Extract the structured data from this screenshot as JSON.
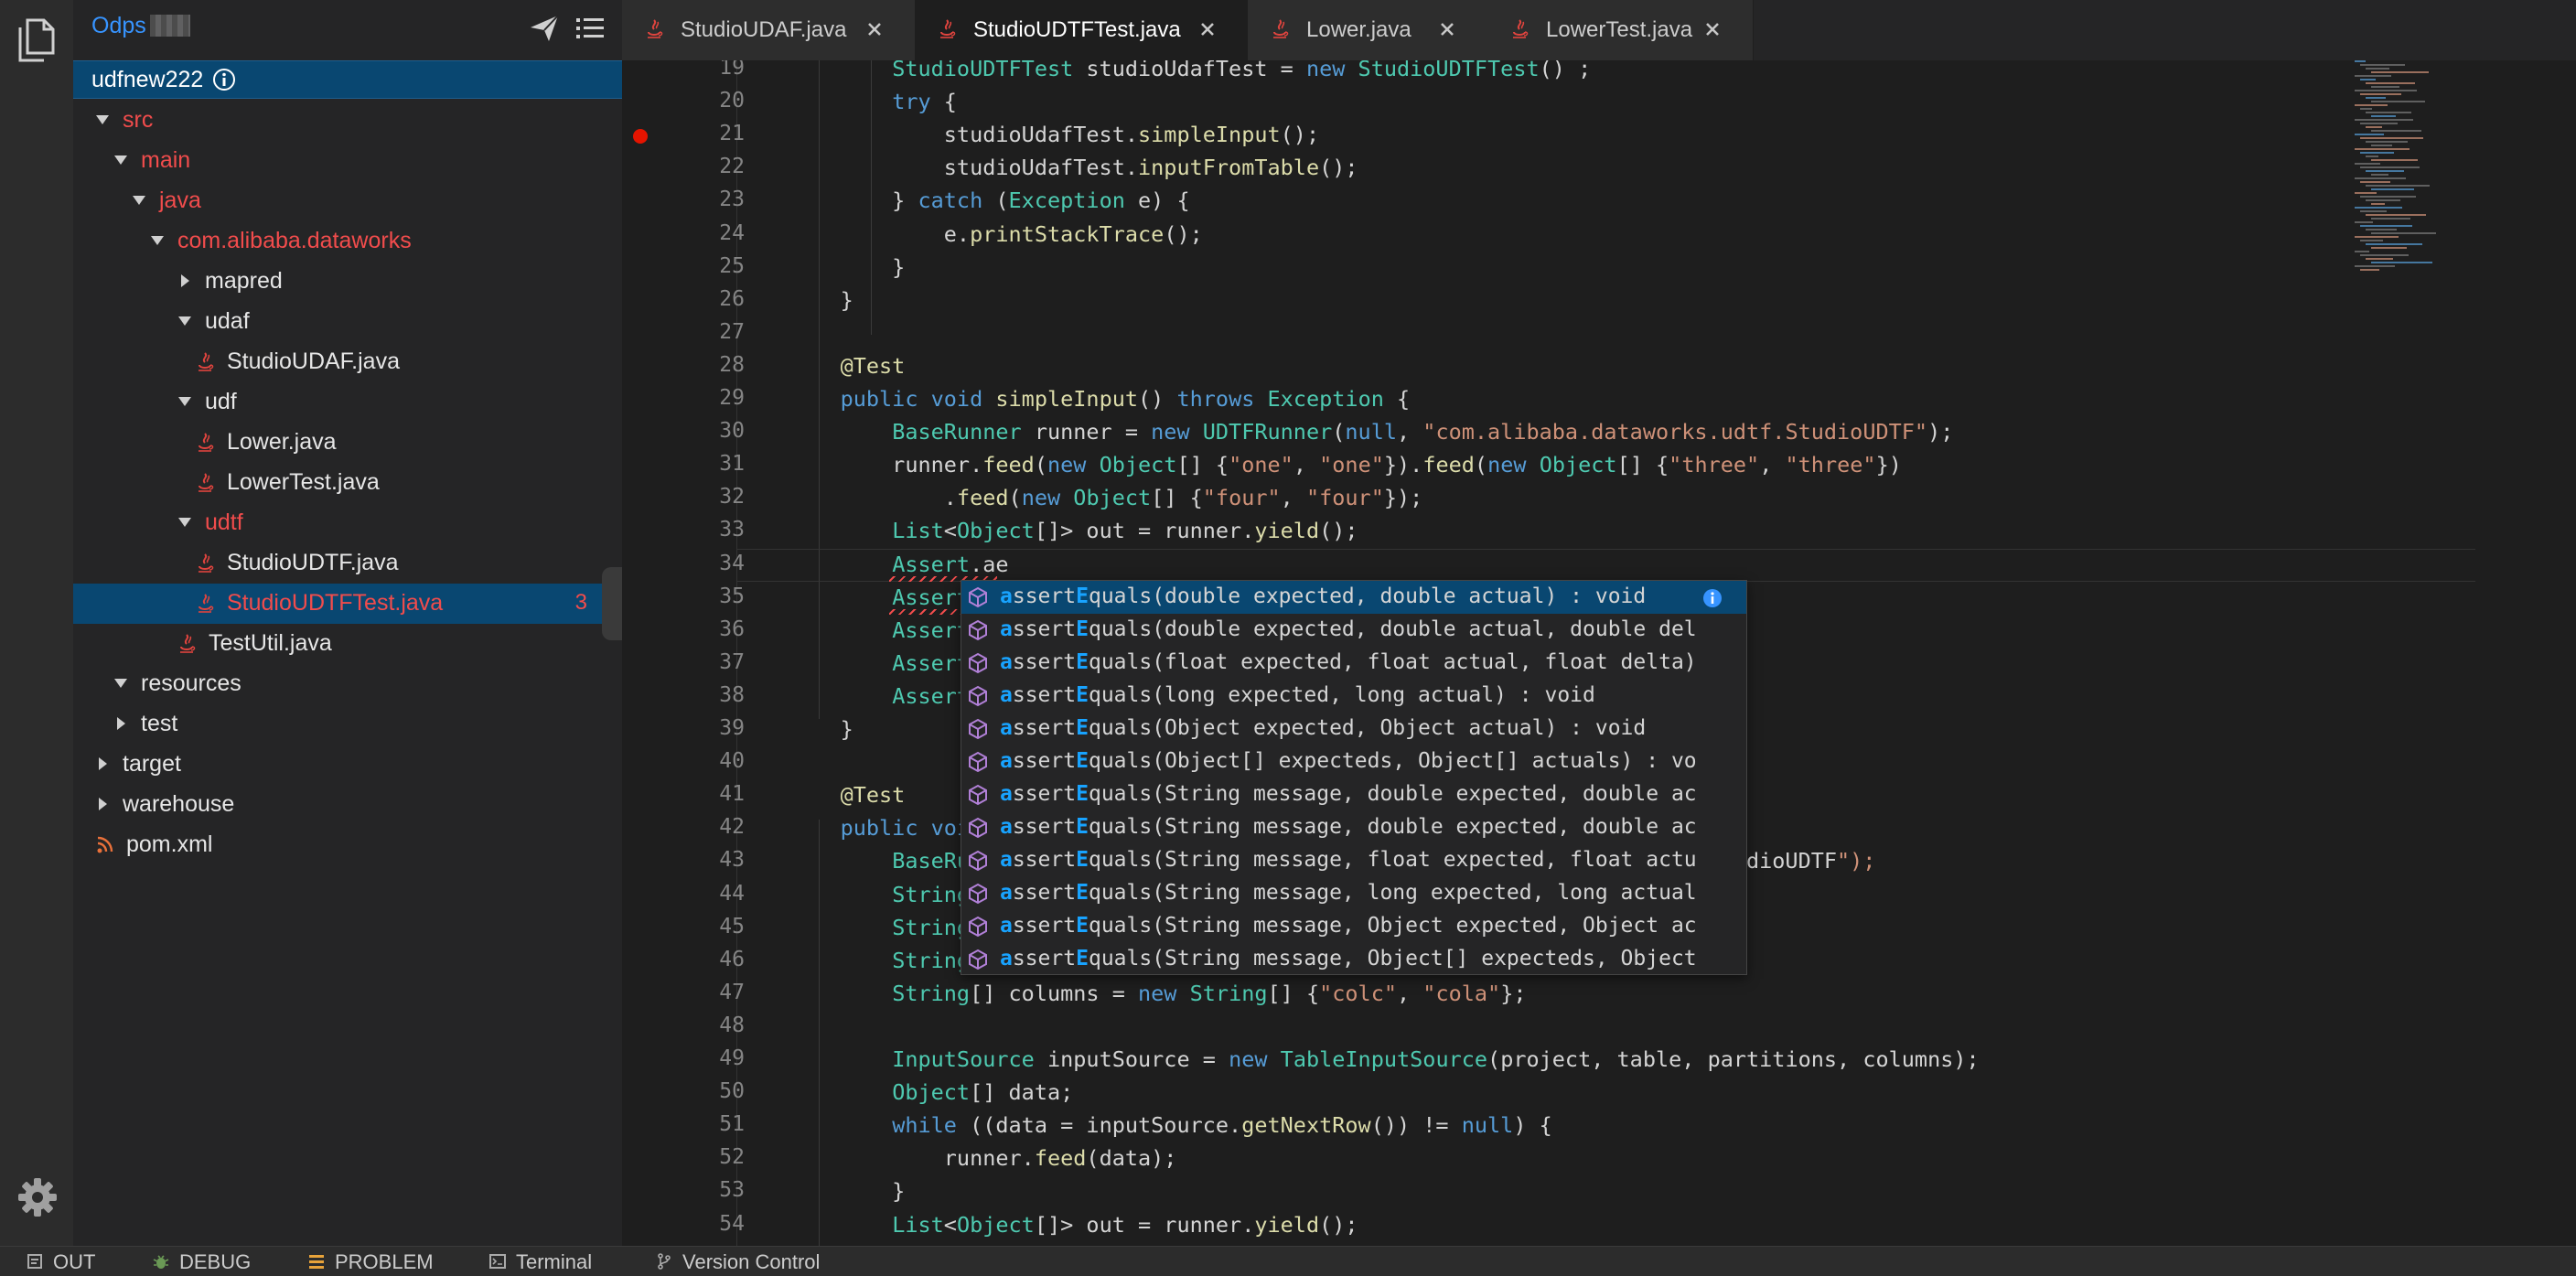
{
  "sidebar": {
    "title": "Odps",
    "project": "udfnew222",
    "tree": [
      {
        "label": "src",
        "color": "red",
        "expanded": true
      },
      {
        "label": "main",
        "color": "red",
        "expanded": true
      },
      {
        "label": "java",
        "color": "red",
        "expanded": true
      },
      {
        "label": "com.alibaba.dataworks",
        "color": "red",
        "expanded": true
      },
      {
        "label": "mapred",
        "color": "white",
        "expanded": false
      },
      {
        "label": "udaf",
        "color": "white",
        "expanded": true
      },
      {
        "label": "StudioUDAF.java",
        "color": "white",
        "icon": "java-file-icon"
      },
      {
        "label": "udf",
        "color": "white",
        "expanded": true
      },
      {
        "label": "Lower.java",
        "color": "white",
        "icon": "java-file-icon"
      },
      {
        "label": "LowerTest.java",
        "color": "white",
        "icon": "java-file-icon"
      },
      {
        "label": "udtf",
        "color": "red",
        "expanded": true
      },
      {
        "label": "StudioUDTF.java",
        "color": "white",
        "icon": "java-file-icon"
      },
      {
        "label": "StudioUDTFTest.java",
        "color": "red",
        "icon": "java-file-icon",
        "selected": true,
        "badge": "3"
      },
      {
        "label": "TestUtil.java",
        "color": "white",
        "icon": "java-file-icon"
      },
      {
        "label": "resources",
        "color": "white",
        "expanded": true
      },
      {
        "label": "test",
        "color": "white",
        "expanded": false
      },
      {
        "label": "target",
        "color": "white",
        "expanded": false
      },
      {
        "label": "warehouse",
        "color": "white",
        "expanded": false
      },
      {
        "label": "pom.xml",
        "color": "white",
        "icon": "rss-file-icon"
      }
    ]
  },
  "tabs": [
    {
      "label": "StudioUDAF.java",
      "active": false
    },
    {
      "label": "StudioUDTFTest.java",
      "active": true
    },
    {
      "label": "Lower.java",
      "active": false
    },
    {
      "label": "LowerTest.java",
      "active": false
    }
  ],
  "editor": {
    "lines": [
      {
        "n": "19",
        "text": "        StudioUDTFTest studioUdafTest = new StudioUDTFTest() ;"
      },
      {
        "n": "20",
        "text": "        try {"
      },
      {
        "n": "21",
        "text": "            studioUdafTest.simpleInput();",
        "breakpoint": true
      },
      {
        "n": "22",
        "text": "            studioUdafTest.inputFromTable();"
      },
      {
        "n": "23",
        "text": "        } catch (Exception e) {"
      },
      {
        "n": "24",
        "text": "            e.printStackTrace();"
      },
      {
        "n": "25",
        "text": "        }"
      },
      {
        "n": "26",
        "text": "    }"
      },
      {
        "n": "27",
        "text": ""
      },
      {
        "n": "28",
        "text": "    @Test"
      },
      {
        "n": "29",
        "text": "    public void simpleInput() throws Exception {"
      },
      {
        "n": "30",
        "text": "        BaseRunner runner = new UDTFRunner(null, \"com.alibaba.dataworks.udtf.StudioUDTF\");"
      },
      {
        "n": "31",
        "text": "        runner.feed(new Object[] {\"one\", \"one\"}).feed(new Object[] {\"three\", \"three\"})"
      },
      {
        "n": "32",
        "text": "            .feed(new Object[] {\"four\", \"four\"});"
      },
      {
        "n": "33",
        "text": "        List<Object[]> out = runner.yield();"
      },
      {
        "n": "34",
        "text": "        Assert.ae"
      },
      {
        "n": "35",
        "text": "        Assert.as"
      },
      {
        "n": "36",
        "text": "        Assert.as"
      },
      {
        "n": "37",
        "text": "        Assert.as"
      },
      {
        "n": "38",
        "text": "        Assert.as"
      },
      {
        "n": "39",
        "text": "    }"
      },
      {
        "n": "40",
        "text": ""
      },
      {
        "n": "41",
        "text": "    @Test"
      },
      {
        "n": "42",
        "text": "    public void i"
      },
      {
        "n": "43",
        "text": "        BaseRunne                                                     .StudioUDTF\");"
      },
      {
        "n": "44",
        "text": "        String pr"
      },
      {
        "n": "45",
        "text": "        String ta"
      },
      {
        "n": "46",
        "text": "        String[]"
      },
      {
        "n": "47",
        "text": "        String[] columns = new String[] {\"colc\", \"cola\"};"
      },
      {
        "n": "48",
        "text": ""
      },
      {
        "n": "49",
        "text": "        InputSource inputSource = new TableInputSource(project, table, partitions, columns);"
      },
      {
        "n": "50",
        "text": "        Object[] data;"
      },
      {
        "n": "51",
        "text": "        while ((data = inputSource.getNextRow()) != null) {"
      },
      {
        "n": "52",
        "text": "            runner.feed(data);"
      },
      {
        "n": "53",
        "text": "        }"
      },
      {
        "n": "54",
        "text": "        List<Object[]> out = runner.yield();"
      }
    ]
  },
  "suggestions": [
    {
      "prefix": "a",
      "match": "ssertE",
      "rest": "quals(double expected, double actual) : void",
      "selected": true
    },
    {
      "prefix": "a",
      "match": "ssertE",
      "rest": "quals(double expected, double actual, double del"
    },
    {
      "prefix": "a",
      "match": "ssertE",
      "rest": "quals(float expected, float actual, float delta)"
    },
    {
      "prefix": "a",
      "match": "ssertE",
      "rest": "quals(long expected, long actual) : void"
    },
    {
      "prefix": "a",
      "match": "ssertE",
      "rest": "quals(Object expected, Object actual) : void"
    },
    {
      "prefix": "a",
      "match": "ssertE",
      "rest": "quals(Object[] expecteds, Object[] actuals) : vo"
    },
    {
      "prefix": "a",
      "match": "ssertE",
      "rest": "quals(String message, double expected, double ac"
    },
    {
      "prefix": "a",
      "match": "ssertE",
      "rest": "quals(String message, double expected, double ac"
    },
    {
      "prefix": "a",
      "match": "ssertE",
      "rest": "quals(String message, float expected, float actu"
    },
    {
      "prefix": "a",
      "match": "ssertE",
      "rest": "quals(String message, long expected, long actual"
    },
    {
      "prefix": "a",
      "match": "ssertE",
      "rest": "quals(String message, Object expected, Object ac"
    },
    {
      "prefix": "a",
      "match": "ssertE",
      "rest": "quals(String message, Object[] expecteds, Object"
    }
  ],
  "statusbar": [
    {
      "label": "OUT",
      "icon": "output-icon"
    },
    {
      "label": "DEBUG",
      "icon": "bug-icon"
    },
    {
      "label": "PROBLEM",
      "icon": "problem-list-icon"
    },
    {
      "label": "Terminal",
      "icon": "terminal-icon"
    },
    {
      "label": "Version Control",
      "icon": "git-branch-icon"
    }
  ],
  "colors": {
    "accent": "#3794ff",
    "selection": "#094771",
    "error": "#f14c4c",
    "match_highlight": "#18a3ff"
  }
}
